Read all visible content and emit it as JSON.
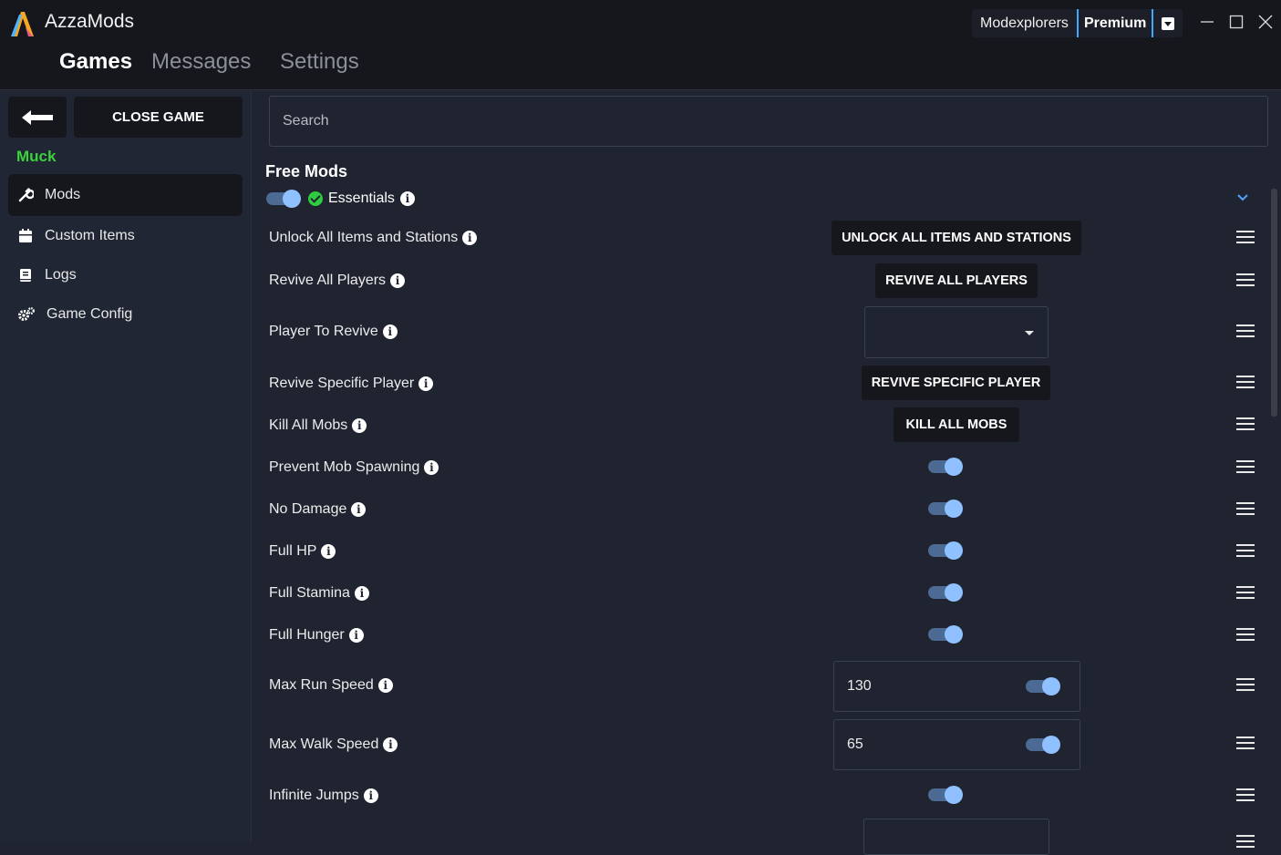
{
  "window": {
    "title": "AzzaMods",
    "account_name": "Modexplorers",
    "account_tier": "Premium"
  },
  "nav": {
    "tabs": [
      {
        "label": "Games",
        "active": true
      },
      {
        "label": "Messages",
        "active": false
      },
      {
        "label": "Settings",
        "active": false
      }
    ]
  },
  "sidebar": {
    "close_label": "CLOSE GAME",
    "game_name": "Muck",
    "items": [
      {
        "label": "Mods",
        "icon": "wrench-icon",
        "active": true
      },
      {
        "label": "Custom Items",
        "icon": "calendar-icon",
        "active": false
      },
      {
        "label": "Logs",
        "icon": "book-icon",
        "active": false
      },
      {
        "label": "Game Config",
        "icon": "gears-icon",
        "active": false
      }
    ]
  },
  "main": {
    "search_placeholder": "Search",
    "section_title": "Free Mods",
    "group_label": "Essentials",
    "mods": [
      {
        "label": "Unlock All Items and Stations",
        "control": "button",
        "button_label": "UNLOCK ALL ITEMS AND STATIONS"
      },
      {
        "label": "Revive All Players",
        "control": "button",
        "button_label": "REVIVE ALL PLAYERS"
      },
      {
        "label": "Player To Revive",
        "control": "dropdown",
        "value": ""
      },
      {
        "label": "Revive Specific Player",
        "control": "button",
        "button_label": "REVIVE SPECIFIC PLAYER"
      },
      {
        "label": "Kill All Mobs",
        "control": "button",
        "button_label": "KILL ALL MOBS"
      },
      {
        "label": "Prevent Mob Spawning",
        "control": "toggle",
        "on": true
      },
      {
        "label": "No Damage",
        "control": "toggle",
        "on": true
      },
      {
        "label": "Full HP",
        "control": "toggle",
        "on": true
      },
      {
        "label": "Full Stamina",
        "control": "toggle",
        "on": true
      },
      {
        "label": "Full Hunger",
        "control": "toggle",
        "on": true
      },
      {
        "label": "Max Run Speed",
        "control": "number",
        "value": "130",
        "on": true
      },
      {
        "label": "Max Walk Speed",
        "control": "number",
        "value": "65",
        "on": true
      },
      {
        "label": "Infinite Jumps",
        "control": "toggle",
        "on": true
      }
    ]
  },
  "colors": {
    "accent": "#8fc0ff",
    "game_name": "#3bd23b",
    "premium_border": "#3fa8ff"
  }
}
